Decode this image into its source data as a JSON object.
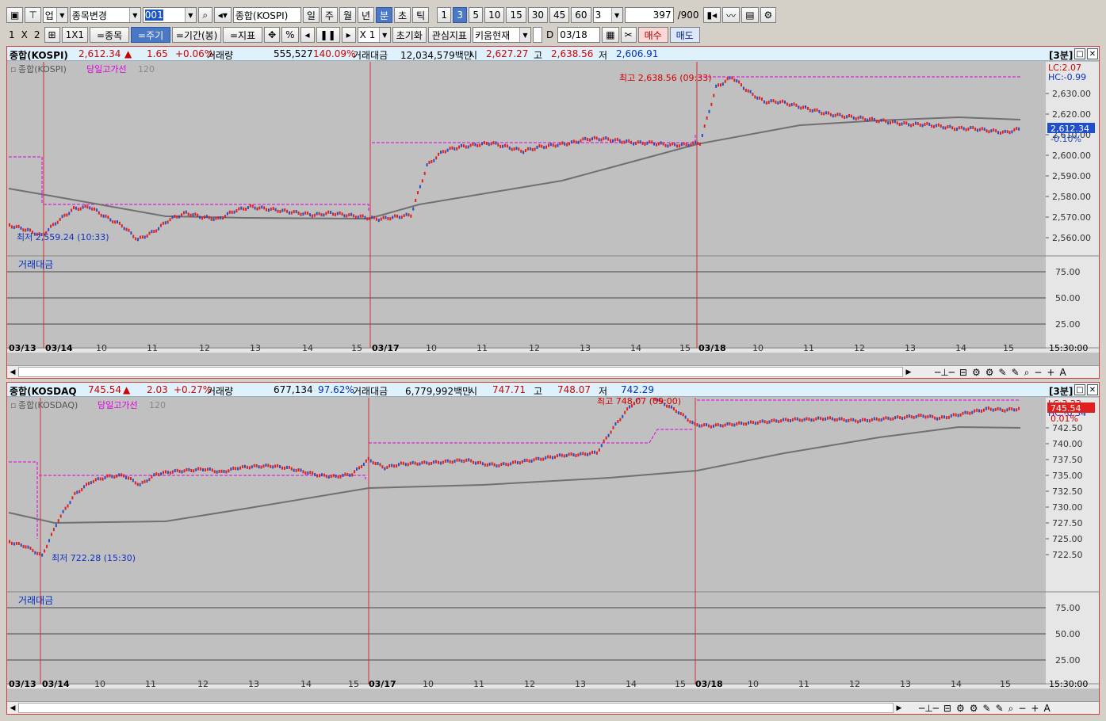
{
  "toolbar1": {
    "market": "업",
    "change_item": "종목변경",
    "code": "001",
    "name": "종합(KOSPI)",
    "periods": [
      "일",
      "주",
      "월",
      "년",
      "분",
      "초",
      "틱"
    ],
    "active_period": "분",
    "intervals": [
      "1",
      "3",
      "5",
      "10",
      "15",
      "30",
      "45",
      "60"
    ],
    "active_interval": "3",
    "interval_select": "3",
    "count": "397",
    "count_max": "/900"
  },
  "toolbar2": {
    "layout_1": "1",
    "layout_x": "X",
    "layout_2": "2",
    "one_by_one": "1X1",
    "eq_item": "=종목",
    "eq_period": "=주기",
    "eq_range": "=기간(봉)",
    "eq_indicator": "=지표",
    "percent": "%",
    "zoom": "X 1",
    "reset": "초기화",
    "interest": "관심지표",
    "kiwoom": "키움현재",
    "d_label": "D",
    "date": "03/18",
    "buy": "매수",
    "sell": "매도"
  },
  "kospi": {
    "header": {
      "name": "종합(KOSPI)",
      "price": "2,612.34",
      "arrow": "▲",
      "change": "1.65",
      "pct": "+0.06%",
      "vol_label": "거래량",
      "vol": "555,527",
      "vol_pct": "140.09%",
      "amt_label": "거래대금",
      "amt": "12,034,579백만",
      "open_label": "시",
      "open": "2,627.27",
      "high_label": "고",
      "high": "2,638.56",
      "low_label": "저",
      "low": "2,606.91",
      "period_tag": "[3분]"
    },
    "legend": {
      "name": "종합(KOSPI)",
      "line": "당일고가선",
      "ma": "120"
    },
    "sub_title": "거래대금",
    "max_note": "최고 2,638.56 (09:33)",
    "min_note": "최저 2,559.24 (10:33)",
    "lc": "LC:2.07",
    "hc": "HC:-0.99",
    "price_tag": "2,612.34",
    "pct_tag": "-0.10%",
    "axis": [
      "2,630.00",
      "2,620.00",
      "2,610.00",
      "2,600.00",
      "2,590.00",
      "2,580.00",
      "2,570.00",
      "2,560.00"
    ],
    "sub_axis": [
      "75.00",
      "50.00",
      "25.00"
    ],
    "time_end": "15:30:00",
    "dates": [
      "03/13",
      "03/14",
      "03/17",
      "03/18"
    ],
    "hours": [
      "10",
      "11",
      "12",
      "13",
      "14",
      "15"
    ],
    "series": [
      2566,
      2564,
      2561,
      2568,
      2574,
      2575,
      2570,
      2566,
      2559,
      2563,
      2569,
      2572,
      2570,
      2569,
      2573,
      2575,
      2574,
      2573,
      2572,
      2571,
      2572,
      2571,
      2570,
      2569,
      2570,
      2571,
      2595,
      2602,
      2604,
      2605,
      2606,
      2604,
      2602,
      2604,
      2605,
      2606,
      2608,
      2608,
      2607,
      2606,
      2606,
      2605,
      2605,
      2606,
      2633,
      2638,
      2631,
      2626,
      2626,
      2624,
      2622,
      2620,
      2619,
      2618,
      2617,
      2616,
      2615,
      2615,
      2614,
      2613,
      2613,
      2612,
      2611,
      2613
    ]
  },
  "kosdaq": {
    "header": {
      "name": "종합(KOSDAQ",
      "price": "745.54",
      "arrow": "▲",
      "change": "2.03",
      "pct": "+0.27%",
      "vol_label": "거래량",
      "vol": "677,134",
      "vol_pct": "97.62%",
      "amt_label": "거래대금",
      "amt": "6,779,992백만",
      "open_label": "시",
      "open": "747.71",
      "high_label": "고",
      "high": "748.07",
      "low_label": "저",
      "low": "742.29",
      "period_tag": "[3분]"
    },
    "legend": {
      "name": "종합(KOSDAQ)",
      "line": "당일고가선",
      "ma": "120"
    },
    "sub_title": "거래대금",
    "max_note": "최고 748.07 (09:00)",
    "min_note": "최저 722.28 (15:30)",
    "lc": "LC:3.22",
    "hc": "HC:-0.34",
    "price_tag": "745.54",
    "pct_tag": "0.01%",
    "axis": [
      "742.50",
      "740.00",
      "737.50",
      "735.00",
      "732.50",
      "730.00",
      "727.50",
      "725.00",
      "722.50"
    ],
    "sub_axis": [
      "75.00",
      "50.00",
      "25.00"
    ],
    "time_end": "15:30:00",
    "dates": [
      "03/13",
      "03/14",
      "03/17",
      "03/18"
    ],
    "hours": [
      "10",
      "11",
      "12",
      "13",
      "14",
      "15"
    ],
    "series": [
      724.5,
      723.8,
      722.3,
      728.0,
      732.0,
      734.0,
      734.8,
      735.0,
      733.5,
      735.2,
      735.6,
      735.8,
      736.0,
      735.5,
      736.2,
      736.4,
      736.5,
      736.2,
      735.6,
      735.0,
      734.8,
      735.2,
      737.5,
      736.2,
      736.8,
      736.9,
      737.0,
      737.2,
      737.4,
      736.8,
      736.6,
      737.0,
      737.4,
      737.8,
      738.2,
      738.3,
      738.6,
      742.5,
      745.8,
      748.0,
      746.5,
      745.0,
      743.0,
      742.8,
      743.0,
      743.2,
      743.4,
      743.6,
      743.8,
      743.8,
      744.0,
      743.8,
      743.6,
      743.8,
      744.0,
      744.2,
      744.4,
      744.0,
      744.5,
      745.0,
      745.5,
      745.3,
      745.54
    ]
  }
}
